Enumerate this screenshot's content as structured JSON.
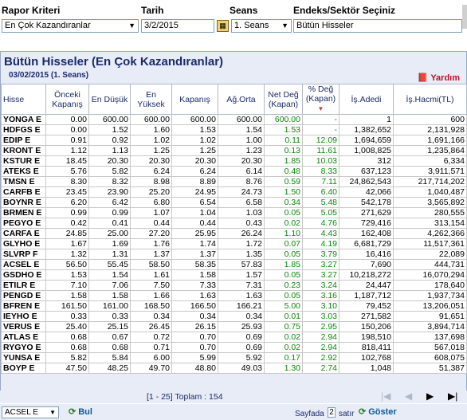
{
  "filters": {
    "rapor_label": "Rapor Kriteri",
    "rapor_value": "En Çok Kazandıranlar",
    "tarih_label": "Tarih",
    "tarih_value": "3/2/2015",
    "seans_label": "Seans",
    "seans_value": "1. Seans",
    "endeks_label": "Endeks/Sektör Seçiniz",
    "endeks_value": "Bütün Hisseler"
  },
  "panel": {
    "title": "Bütün Hisseler (En Çok Kazandıranlar)",
    "subtitle": "03/02/2015 (1. Seans)",
    "help": "Yardım"
  },
  "table": {
    "headers": [
      "Hisse",
      "Önceki Kapanış",
      "En Düşük",
      "En Yüksek",
      "Kapanış",
      "Ağ.Orta",
      "Net Değ (Kapan)",
      "% Değ (Kapan)",
      "İş.Adedi",
      "İş.Hacmi(TL)"
    ],
    "rows": [
      [
        "YONGA E",
        "0.00",
        "600.00",
        "600.00",
        "600.00",
        "600.00",
        "600.00",
        "-",
        "1",
        "600"
      ],
      [
        "HDFGS E",
        "0.00",
        "1.52",
        "1.60",
        "1.53",
        "1.54",
        "1.53",
        "-",
        "1,382,652",
        "2,131,928"
      ],
      [
        "EDIP E",
        "0.91",
        "0.92",
        "1.02",
        "1.02",
        "1.00",
        "0.11",
        "12.09",
        "1,694,659",
        "1,691,166"
      ],
      [
        "KRONT E",
        "1.12",
        "1.13",
        "1.25",
        "1.25",
        "1.23",
        "0.13",
        "11.61",
        "1,008,825",
        "1,235,864"
      ],
      [
        "KSTUR E",
        "18.45",
        "20.30",
        "20.30",
        "20.30",
        "20.30",
        "1.85",
        "10.03",
        "312",
        "6,334"
      ],
      [
        "ATEKS E",
        "5.76",
        "5.82",
        "6.24",
        "6.24",
        "6.14",
        "0.48",
        "8.33",
        "637,123",
        "3,911,571"
      ],
      [
        "TMSN E",
        "8.30",
        "8.32",
        "8.98",
        "8.89",
        "8.76",
        "0.59",
        "7.11",
        "24,862,543",
        "217,714,202"
      ],
      [
        "CARFB E",
        "23.45",
        "23.90",
        "25.20",
        "24.95",
        "24.73",
        "1.50",
        "6.40",
        "42,066",
        "1,040,487"
      ],
      [
        "BOYNR E",
        "6.20",
        "6.42",
        "6.80",
        "6.54",
        "6.58",
        "0.34",
        "5.48",
        "542,178",
        "3,565,892"
      ],
      [
        "BRMEN E",
        "0.99",
        "0.99",
        "1.07",
        "1.04",
        "1.03",
        "0.05",
        "5.05",
        "271,629",
        "280,555"
      ],
      [
        "PEGYO E",
        "0.42",
        "0.41",
        "0.44",
        "0.44",
        "0.43",
        "0.02",
        "4.76",
        "729,416",
        "313,154"
      ],
      [
        "CARFA E",
        "24.85",
        "25.00",
        "27.20",
        "25.95",
        "26.24",
        "1.10",
        "4.43",
        "162,408",
        "4,262,366"
      ],
      [
        "GLYHO E",
        "1.67",
        "1.69",
        "1.76",
        "1.74",
        "1.72",
        "0.07",
        "4.19",
        "6,681,729",
        "11,517,361"
      ],
      [
        "SLVRP F",
        "1.32",
        "1.31",
        "1.37",
        "1.37",
        "1.35",
        "0.05",
        "3.79",
        "16,416",
        "22,089"
      ],
      [
        "ACSEL E",
        "56.50",
        "55.45",
        "58.50",
        "58.35",
        "57.83",
        "1.85",
        "3.27",
        "7,690",
        "444,731"
      ],
      [
        "GSDHO E",
        "1.53",
        "1.54",
        "1.61",
        "1.58",
        "1.57",
        "0.05",
        "3.27",
        "10,218,272",
        "16,070,294"
      ],
      [
        "ETILR E",
        "7.10",
        "7.06",
        "7.50",
        "7.33",
        "7.31",
        "0.23",
        "3.24",
        "24,447",
        "178,640"
      ],
      [
        "PENGD E",
        "1.58",
        "1.58",
        "1.66",
        "1.63",
        "1.63",
        "0.05",
        "3.16",
        "1,187,712",
        "1,937,734"
      ],
      [
        "BFREN E",
        "161.50",
        "161.00",
        "168.50",
        "166.50",
        "166.21",
        "5.00",
        "3.10",
        "79,452",
        "13,206,051"
      ],
      [
        "IEYHO E",
        "0.33",
        "0.33",
        "0.34",
        "0.34",
        "0.34",
        "0.01",
        "3.03",
        "271,582",
        "91,651"
      ],
      [
        "VERUS E",
        "25.40",
        "25.15",
        "26.45",
        "26.15",
        "25.93",
        "0.75",
        "2.95",
        "150,206",
        "3,894,714"
      ],
      [
        "ATLAS E",
        "0.68",
        "0.67",
        "0.72",
        "0.70",
        "0.69",
        "0.02",
        "2.94",
        "198,510",
        "137,698"
      ],
      [
        "RYGYO E",
        "0.68",
        "0.68",
        "0.71",
        "0.70",
        "0.69",
        "0.02",
        "2.94",
        "818,411",
        "567,018"
      ],
      [
        "YUNSA E",
        "5.82",
        "5.84",
        "6.00",
        "5.99",
        "5.92",
        "0.17",
        "2.92",
        "102,768",
        "608,075"
      ],
      [
        "BOYP E",
        "47.50",
        "48.25",
        "49.70",
        "48.80",
        "49.03",
        "1.30",
        "2.74",
        "1,048",
        "51,387"
      ]
    ]
  },
  "pager": {
    "text": "[1 - 25] Toplam : 154"
  },
  "bottom": {
    "stock_select": "ACSEL E",
    "bul_label": "Bul",
    "sayfa_label": "Sayfada",
    "sayfa_value": "2",
    "satir_label": "satır",
    "goster_label": "Göster"
  },
  "colors": {
    "panel_bg": "#e8ecf7",
    "title": "#1a2a6a",
    "net_change": "#0a8a0a",
    "help": "#c0102a"
  }
}
